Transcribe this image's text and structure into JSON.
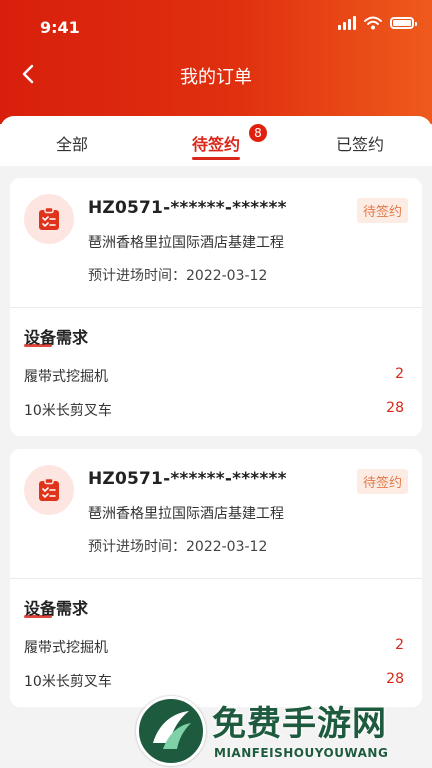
{
  "status_bar": {
    "time": "9:41"
  },
  "header": {
    "title": "我的订单"
  },
  "tabs": [
    {
      "label": "全部",
      "active": false
    },
    {
      "label": "待签约",
      "active": true,
      "badge": "8"
    },
    {
      "label": "已签约",
      "active": false
    }
  ],
  "orders": [
    {
      "order_no": "HZ0571-******-******",
      "status": "待签约",
      "project": "琶洲香格里拉国际酒店基建工程",
      "date_label": "预计进场时间：",
      "date": "2022-03-12",
      "req_title": "设备需求",
      "items": [
        {
          "name": "履带式挖掘机",
          "qty": "2"
        },
        {
          "name": "10米长剪叉车",
          "qty": "28"
        }
      ]
    },
    {
      "order_no": "HZ0571-******-******",
      "status": "待签约",
      "project": "琶洲香格里拉国际酒店基建工程",
      "date_label": "预计进场时间：",
      "date": "2022-03-12",
      "req_title": "设备需求",
      "items": [
        {
          "name": "履带式挖掘机",
          "qty": "2"
        },
        {
          "name": "10米长剪叉车",
          "qty": "28"
        }
      ]
    }
  ],
  "watermark": {
    "title": "免费手游网",
    "subtitle": "MIANFEISHOUYOUWANG"
  },
  "colors": {
    "accent": "#d9281a",
    "header_start": "#d81f0c",
    "header_end": "#ef5a1c",
    "status_badge_bg": "#fdece4",
    "status_badge_text": "#e07a4a"
  }
}
